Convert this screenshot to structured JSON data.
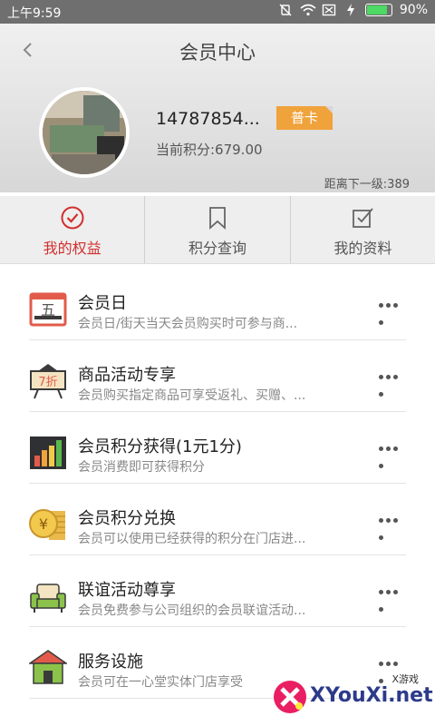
{
  "status_bar": {
    "time": "上午9:59",
    "battery_percent": "90%",
    "battery_level": 0.9
  },
  "header": {
    "title": "会员中心",
    "username": "14787854...",
    "card_type": "普卡",
    "points": "当前积分:679.00",
    "next_level": "距离下一级:389"
  },
  "tabs": [
    {
      "label": "我的权益",
      "icon": "check-circle-icon",
      "active": true
    },
    {
      "label": "积分查询",
      "icon": "bookmark-icon",
      "active": false
    },
    {
      "label": "我的资料",
      "icon": "checkbox-icon",
      "active": false
    }
  ],
  "items": [
    {
      "title": "会员日",
      "desc": "会员日/街天当天会员购买时可参与商...",
      "icon": "calendar-icon",
      "icon_text": "五"
    },
    {
      "title": "商品活动专享",
      "desc": "会员购买指定商品可享受返礼、买赠、...",
      "icon": "discount-sign-icon",
      "icon_text": "7折"
    },
    {
      "title": "会员积分获得(1元1分)",
      "desc": "会员消费即可获得积分",
      "icon": "bar-chart-icon"
    },
    {
      "title": "会员积分兑换",
      "desc": "会员可以使用已经获得的积分在门店进...",
      "icon": "coin-stack-icon"
    },
    {
      "title": "联谊活动尊享",
      "desc": "会员免费参与公司组织的会员联谊活动...",
      "icon": "sofa-icon"
    },
    {
      "title": "服务设施",
      "desc": "会员可在一心堂实体门店享受",
      "icon": "store-icon"
    }
  ],
  "watermark": {
    "small": "X游戏",
    "big": "XYouXi.net"
  },
  "colors": {
    "accent_red": "#d32f2f",
    "badge_orange": "#f0a23b"
  }
}
